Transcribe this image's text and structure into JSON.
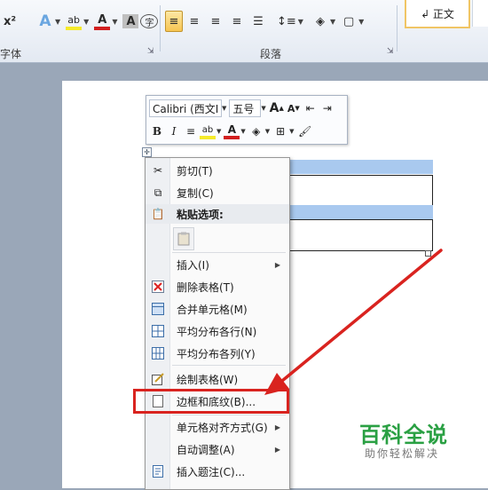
{
  "ribbon": {
    "font_group_label": "字体",
    "paragraph_group_label": "段落",
    "style_normal": "↲ 正文",
    "superscript": "x²",
    "font_color_letter": "A",
    "char_shading_letter": "A",
    "char_border": "字",
    "highlight": "ab",
    "launcher": "⇲"
  },
  "mini_toolbar": {
    "font_name": "Calibri (西文I",
    "font_size": "五号",
    "grow_font": "A",
    "shrink_font": "A",
    "bold": "B",
    "italic": "I",
    "highlight": "ab",
    "font_color": "A"
  },
  "context_menu": {
    "items": [
      {
        "label": "剪切(T)",
        "icon": "scissors-icon"
      },
      {
        "label": "复制(C)",
        "icon": "copy-icon"
      },
      {
        "label": "粘贴选项:",
        "icon": "paste-icon"
      },
      {
        "label": "插入(I)",
        "icon": "",
        "submenu": true
      },
      {
        "label": "删除表格(T)",
        "icon": "delete-table-icon"
      },
      {
        "label": "合并单元格(M)",
        "icon": "merge-cells-icon"
      },
      {
        "label": "平均分布各行(N)",
        "icon": "distribute-rows-icon"
      },
      {
        "label": "平均分布各列(Y)",
        "icon": "distribute-columns-icon"
      },
      {
        "label": "绘制表格(W)",
        "icon": "draw-table-icon"
      },
      {
        "label": "边框和底纹(B)...",
        "icon": "borders-shading-icon"
      },
      {
        "label": "单元格对齐方式(G)",
        "icon": "",
        "submenu": true
      },
      {
        "label": "自动调整(A)",
        "icon": "",
        "submenu": true
      },
      {
        "label": "插入题注(C)...",
        "icon": "insert-caption-icon"
      }
    ]
  },
  "watermark": {
    "title": "百科全说",
    "subtitle": "助你轻松解决"
  },
  "colors": {
    "highlight_red": "#d9231f",
    "selection_blue": "#a9c9ef",
    "watermark_green": "#2aa043"
  }
}
